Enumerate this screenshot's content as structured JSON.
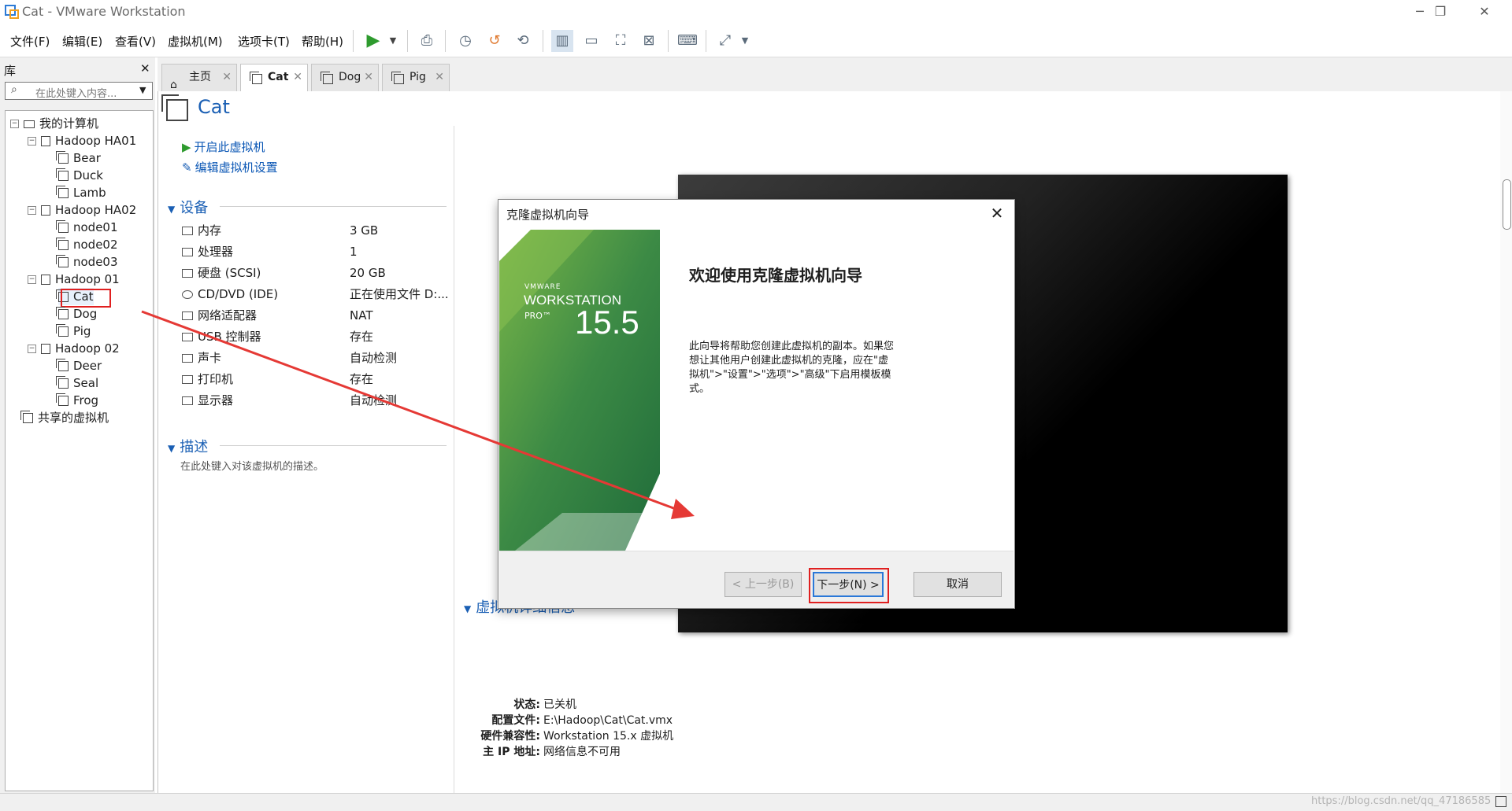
{
  "window": {
    "title": "Cat - VMware Workstation",
    "controls": {
      "minimize": "─",
      "restore": "❐",
      "close": "✕"
    }
  },
  "menu": [
    "文件(F)",
    "编辑(E)",
    "查看(V)",
    "虚拟机(M)",
    "选项卡(T)",
    "帮助(H)"
  ],
  "library": {
    "title": "库",
    "close": "✕",
    "search_placeholder": "在此处键入内容...",
    "tree": {
      "root": "我的计算机",
      "groups": [
        {
          "name": "Hadoop HA01",
          "vms": [
            "Bear",
            "Duck",
            "Lamb"
          ]
        },
        {
          "name": "Hadoop HA02",
          "vms": [
            "node01",
            "node02",
            "node03"
          ]
        },
        {
          "name": "Hadoop 01",
          "vms": [
            "Cat",
            "Dog",
            "Pig"
          ]
        },
        {
          "name": "Hadoop 02",
          "vms": [
            "Deer",
            "Seal",
            "Frog"
          ]
        }
      ],
      "shared": "共享的虚拟机",
      "selected": "Cat"
    }
  },
  "tabs": [
    {
      "label": "主页",
      "active": false
    },
    {
      "label": "Cat",
      "active": true
    },
    {
      "label": "Dog",
      "active": false
    },
    {
      "label": "Pig",
      "active": false
    }
  ],
  "vm": {
    "name": "Cat",
    "actions": {
      "power_on": "开启此虚拟机",
      "edit_settings": "编辑虚拟机设置"
    },
    "devices_title": "设备",
    "devices": [
      {
        "name": "内存",
        "value": "3 GB",
        "icon": "memory-icon"
      },
      {
        "name": "处理器",
        "value": "1",
        "icon": "cpu-icon"
      },
      {
        "name": "硬盘 (SCSI)",
        "value": "20 GB",
        "icon": "disk-icon"
      },
      {
        "name": "CD/DVD (IDE)",
        "value": "正在使用文件 D:...",
        "icon": "cd-icon"
      },
      {
        "name": "网络适配器",
        "value": "NAT",
        "icon": "network-icon"
      },
      {
        "name": "USB 控制器",
        "value": "存在",
        "icon": "usb-icon"
      },
      {
        "name": "声卡",
        "value": "自动检测",
        "icon": "sound-icon"
      },
      {
        "name": "打印机",
        "value": "存在",
        "icon": "printer-icon"
      },
      {
        "name": "显示器",
        "value": "自动检测",
        "icon": "display-icon"
      }
    ],
    "desc_title": "描述",
    "desc_placeholder": "在此处键入对该虚拟机的描述。",
    "details_title": "虚拟机详细信息",
    "details": [
      {
        "key": "状态:",
        "value": "已关机"
      },
      {
        "key": "配置文件:",
        "value": "E:\\Hadoop\\Cat\\Cat.vmx"
      },
      {
        "key": "硬件兼容性:",
        "value": "Workstation 15.x 虚拟机"
      },
      {
        "key": "主 IP 地址:",
        "value": "网络信息不可用"
      }
    ]
  },
  "dialog": {
    "title": "克隆虚拟机向导",
    "close": "✕",
    "heading": "欢迎使用克隆虚拟机向导",
    "body": "此向导将帮助您创建此虚拟机的副本。如果您想让其他用户创建此虚拟机的克隆，应在\"虚拟机\">\"设置\">\"选项\">\"高级\"下启用模板模式。",
    "brand": {
      "vendor": "VMWARE",
      "product": "WORKSTATION",
      "edition": "PRO™",
      "version": "15.5"
    },
    "buttons": {
      "back": "< 上一步(B)",
      "next": "下一步(N) >",
      "cancel": "取消"
    }
  },
  "watermark": "https://blog.csdn.net/qq_47186585",
  "colors": {
    "accent": "#1a5fb4",
    "highlight_box": "#e02020",
    "arrow": "#e53935",
    "play": "#2e9b2e"
  }
}
